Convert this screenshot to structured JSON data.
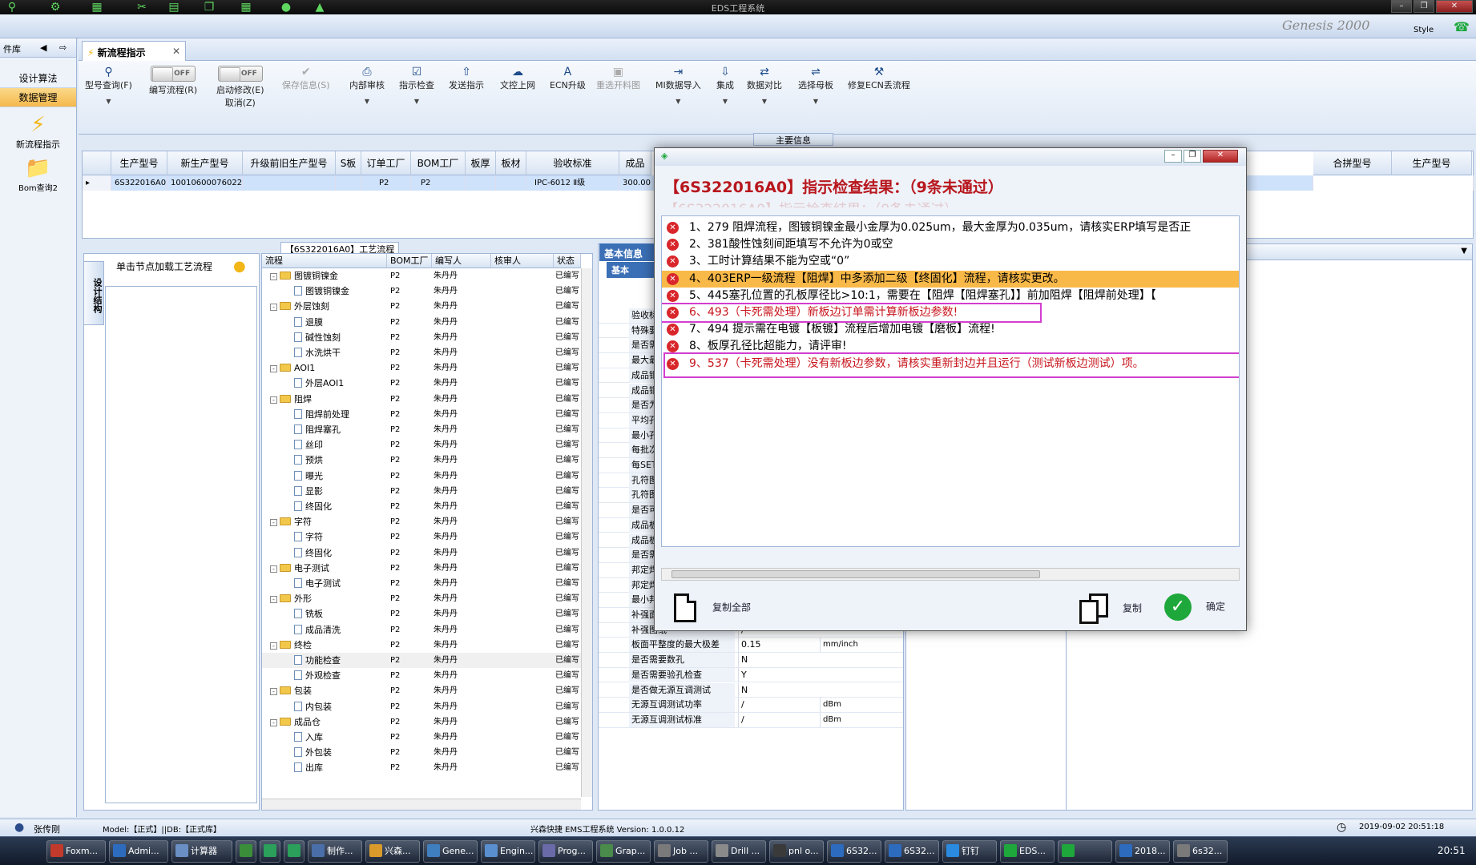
{
  "window": {
    "title": "EDS工程系统",
    "style_label": "Style",
    "brand": "Genesis 2000"
  },
  "leftnav": {
    "header": "件库",
    "items": [
      {
        "label": "设计算法"
      },
      {
        "label": "数据管理"
      }
    ],
    "tiles": [
      {
        "label": "新流程指示"
      },
      {
        "label": "Bom查询2"
      }
    ]
  },
  "tabs": [
    {
      "label": "新流程指示"
    }
  ],
  "ribbon": {
    "buttons": [
      {
        "label": "型号查询(F)"
      },
      {
        "label": "编写流程(R)",
        "toggle": "OFF"
      },
      {
        "label": "启动修改(E)",
        "sub": "取消(Z)",
        "toggle": "OFF"
      },
      {
        "label": "保存信息(S)"
      },
      {
        "label": "内部审核"
      },
      {
        "label": "指示检查"
      },
      {
        "label": "发送指示"
      },
      {
        "label": "文控上网"
      },
      {
        "label": "ECN升级"
      },
      {
        "label": "重选开料图"
      },
      {
        "label": "MI数据导入"
      },
      {
        "label": "集成"
      },
      {
        "label": "数据对比"
      },
      {
        "label": "选择母板"
      },
      {
        "label": "修复ECN丢流程"
      }
    ],
    "group_label": "主要信息"
  },
  "main_grid": {
    "headers": [
      "生产型号",
      "新生产型号",
      "升级前旧生产型号",
      "S板",
      "订单工厂",
      "BOM工厂",
      "板厚",
      "板材",
      "验收标准",
      "成品"
    ],
    "row": [
      "6S322016A0",
      "10010600076022",
      "",
      "",
      "P2",
      "P2",
      "",
      "",
      "IPC-6012 Ⅱ级",
      "300.00"
    ],
    "right_headers": [
      "合拼型号",
      "生产型号"
    ]
  },
  "left_panel": {
    "vertical_tab": "设计结构",
    "hint": "单击节点加载工艺流程"
  },
  "tree": {
    "title": "【6S322016A0】工艺流程",
    "headers": [
      "流程",
      "BOM工厂",
      "编写人",
      "核审人",
      "状态"
    ],
    "rows": [
      {
        "name": "图镀铜镍金",
        "level": 1,
        "type": "folder",
        "bom": "P2",
        "writer": "朱丹丹",
        "status": "已编写"
      },
      {
        "name": "图镀铜镍金",
        "level": 2,
        "type": "doc",
        "bom": "P2",
        "writer": "朱丹丹",
        "status": "已编写"
      },
      {
        "name": "外层蚀刻",
        "level": 1,
        "type": "folder",
        "bom": "P2",
        "writer": "朱丹丹",
        "status": "已编写"
      },
      {
        "name": "退膜",
        "level": 2,
        "type": "doc",
        "bom": "P2",
        "writer": "朱丹丹",
        "status": "已编写"
      },
      {
        "name": "碱性蚀刻",
        "level": 2,
        "type": "doc",
        "bom": "P2",
        "writer": "朱丹丹",
        "status": "已编写"
      },
      {
        "name": "水洗烘干",
        "level": 2,
        "type": "doc",
        "bom": "P2",
        "writer": "朱丹丹",
        "status": "已编写"
      },
      {
        "name": "AOI1",
        "level": 1,
        "type": "folder",
        "bom": "P2",
        "writer": "朱丹丹",
        "status": "已编写"
      },
      {
        "name": "外层AOI1",
        "level": 2,
        "type": "doc",
        "bom": "P2",
        "writer": "朱丹丹",
        "status": "已编写"
      },
      {
        "name": "阻焊",
        "level": 1,
        "type": "folder",
        "bom": "P2",
        "writer": "朱丹丹",
        "status": "已编写"
      },
      {
        "name": "阻焊前处理",
        "level": 2,
        "type": "doc",
        "bom": "P2",
        "writer": "朱丹丹",
        "status": "已编写"
      },
      {
        "name": "阻焊塞孔",
        "level": 2,
        "type": "doc",
        "bom": "P2",
        "writer": "朱丹丹",
        "status": "已编写"
      },
      {
        "name": "丝印",
        "level": 2,
        "type": "doc",
        "bom": "P2",
        "writer": "朱丹丹",
        "status": "已编写"
      },
      {
        "name": "预烘",
        "level": 2,
        "type": "doc",
        "bom": "P2",
        "writer": "朱丹丹",
        "status": "已编写"
      },
      {
        "name": "曝光",
        "level": 2,
        "type": "doc",
        "bom": "P2",
        "writer": "朱丹丹",
        "status": "已编写"
      },
      {
        "name": "显影",
        "level": 2,
        "type": "doc",
        "bom": "P2",
        "writer": "朱丹丹",
        "status": "已编写"
      },
      {
        "name": "终固化",
        "level": 2,
        "type": "doc",
        "bom": "P2",
        "writer": "朱丹丹",
        "status": "已编写"
      },
      {
        "name": "字符",
        "level": 1,
        "type": "folder",
        "bom": "P2",
        "writer": "朱丹丹",
        "status": "已编写"
      },
      {
        "name": "字符",
        "level": 2,
        "type": "doc",
        "bom": "P2",
        "writer": "朱丹丹",
        "status": "已编写"
      },
      {
        "name": "终固化",
        "level": 2,
        "type": "doc",
        "bom": "P2",
        "writer": "朱丹丹",
        "status": "已编写"
      },
      {
        "name": "电子测试",
        "level": 1,
        "type": "folder",
        "bom": "P2",
        "writer": "朱丹丹",
        "status": "已编写"
      },
      {
        "name": "电子测试",
        "level": 2,
        "type": "doc",
        "bom": "P2",
        "writer": "朱丹丹",
        "status": "已编写"
      },
      {
        "name": "外形",
        "level": 1,
        "type": "folder",
        "bom": "P2",
        "writer": "朱丹丹",
        "status": "已编写"
      },
      {
        "name": "铣板",
        "level": 2,
        "type": "doc",
        "bom": "P2",
        "writer": "朱丹丹",
        "status": "已编写"
      },
      {
        "name": "成品清洗",
        "level": 2,
        "type": "doc",
        "bom": "P2",
        "writer": "朱丹丹",
        "status": "已编写"
      },
      {
        "name": "终检",
        "level": 1,
        "type": "folder",
        "bom": "P2",
        "writer": "朱丹丹",
        "status": "已编写"
      },
      {
        "name": "功能检查",
        "level": 2,
        "type": "doc",
        "bom": "P2",
        "writer": "朱丹丹",
        "status": "已编写",
        "selected": true
      },
      {
        "name": "外观检查",
        "level": 2,
        "type": "doc",
        "bom": "P2",
        "writer": "朱丹丹",
        "status": "已编写"
      },
      {
        "name": "包装",
        "level": 1,
        "type": "folder",
        "bom": "P2",
        "writer": "朱丹丹",
        "status": "已编写"
      },
      {
        "name": "内包装",
        "level": 2,
        "type": "doc",
        "bom": "P2",
        "writer": "朱丹丹",
        "status": "已编写"
      },
      {
        "name": "成品仓",
        "level": 1,
        "type": "folder",
        "bom": "P2",
        "writer": "朱丹丹",
        "status": "已编写"
      },
      {
        "name": "入库",
        "level": 2,
        "type": "doc",
        "bom": "P2",
        "writer": "朱丹丹",
        "status": "已编写"
      },
      {
        "name": "外包装",
        "level": 2,
        "type": "doc",
        "bom": "P2",
        "writer": "朱丹丹",
        "status": "已编写"
      },
      {
        "name": "出库",
        "level": 2,
        "type": "doc",
        "bom": "P2",
        "writer": "朱丹丹",
        "status": "已编写"
      }
    ]
  },
  "info": {
    "tab": "基本信息",
    "subtab": "基本",
    "rows": [
      {
        "label": "验收标",
        "value": "",
        "unit": ""
      },
      {
        "label": "特殊要",
        "value": "",
        "unit": ""
      },
      {
        "label": "是否需",
        "value": "",
        "unit": ""
      },
      {
        "label": "最大最",
        "value": "",
        "unit": ""
      },
      {
        "label": "成品铜",
        "value": "",
        "unit": ""
      },
      {
        "label": "成品铜",
        "value": "",
        "unit": ""
      },
      {
        "label": "是否为",
        "value": "",
        "unit": ""
      },
      {
        "label": "平均孔",
        "value": "",
        "unit": ""
      },
      {
        "label": "最小孔",
        "value": "",
        "unit": ""
      },
      {
        "label": "每批次",
        "value": "",
        "unit": ""
      },
      {
        "label": "每SET",
        "value": "",
        "unit": ""
      },
      {
        "label": "孔符图",
        "value": "",
        "unit": ""
      },
      {
        "label": "孔符图",
        "value": "",
        "unit": ""
      },
      {
        "label": "是否可",
        "value": "",
        "unit": ""
      },
      {
        "label": "成品板",
        "value": "",
        "unit": ""
      },
      {
        "label": "成品板",
        "value": "",
        "unit": ""
      },
      {
        "label": "是否需",
        "value": "",
        "unit": ""
      },
      {
        "label": "邦定焊",
        "value": "",
        "unit": ""
      },
      {
        "label": "邦定焊盘图纸2",
        "value": "/",
        "unit": ""
      },
      {
        "label": "最小邦定焊盘大小",
        "value": "/",
        "unit": "mil"
      },
      {
        "label": "补强面",
        "value": "/",
        "unit": ""
      },
      {
        "label": "补强图纸",
        "value": "/",
        "unit": ""
      },
      {
        "label": "板面平整度的最大极差",
        "value": "0.15",
        "unit": "mm/inch"
      },
      {
        "label": "是否需要数孔",
        "value": "N",
        "unit": ""
      },
      {
        "label": "是否需要验孔检查",
        "value": "Y",
        "unit": ""
      },
      {
        "label": "是否做无源互调测试",
        "value": "N",
        "unit": ""
      },
      {
        "label": "无源互调测试功率",
        "value": "/",
        "unit": "dBm"
      },
      {
        "label": "无源互调测试标准",
        "value": "/",
        "unit": "dBm"
      }
    ]
  },
  "dialog": {
    "title": "【6S322016A0】指示检查结果：（9条未通过）",
    "messages": [
      "1、279 阻焊流程，图镀铜镍金最小金厚为0.025um，最大金厚为0.035um，请核实ERP填写是否正",
      "2、381酸性蚀刻间距填写不允许为0或空",
      "3、工时计算结果不能为空或“0”",
      "4、403ERP一级流程【阻焊】中多添加二级【终固化】流程，请核实更改。",
      "5、445塞孔位置的孔板厚径比>10:1，需要在【阻焊【阻焊塞孔】】前加阻焊【阻焊前处理】【",
      "6、493（卡死需处理）新板边订单需计算新板边参数!",
      "7、494 提示需在电镀【板镀】流程后增加电镀【磨板】流程!",
      "8、板厚孔径比超能力，请评审!",
      "9、537（卡死需处理）没有新板边参数，请核实重新封边并且运行（测试新板边测试）项。"
    ],
    "copy_all": "复制全部",
    "copy": "复制",
    "ok": "确定"
  },
  "status": {
    "user": "张传刚",
    "model": "Model:【正式】||DB:【正式库】",
    "version": "兴森快捷 EMS工程系统 Version: 1.0.0.12",
    "datetime": "2019-09-02 20:51:18"
  },
  "taskbar": {
    "items": [
      "Foxm...",
      "Admi...",
      "计算器",
      "",
      "",
      "",
      "制作...",
      "兴森...",
      "Gene...",
      "Engin...",
      "Prog...",
      "Grap...",
      "Job ...",
      "Drill ...",
      "pnl o...",
      "6S32...",
      "6S32...",
      "钉钉",
      "EDS...",
      "",
      "2018...",
      "6s32..."
    ],
    "clock": "20:51"
  }
}
